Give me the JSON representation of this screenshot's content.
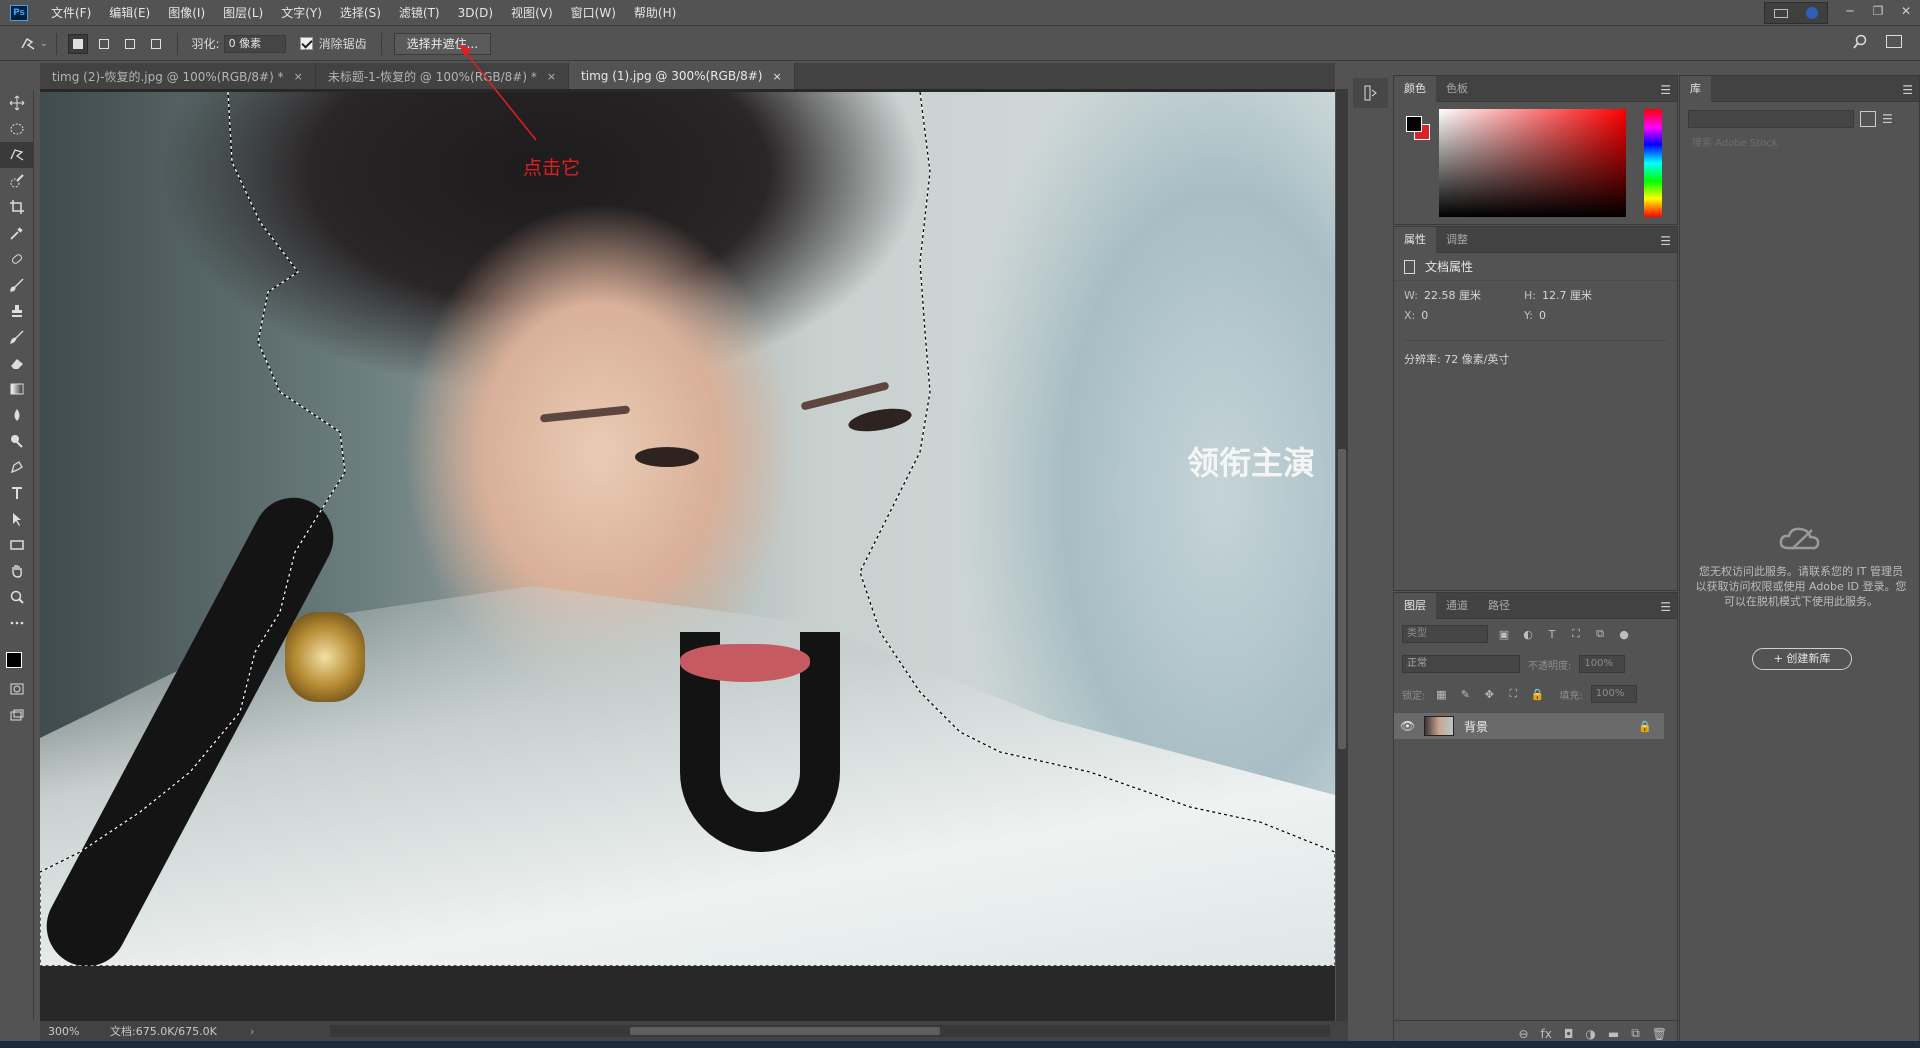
{
  "app": {
    "logo": "Ps"
  },
  "menu": [
    "文件(F)",
    "编辑(E)",
    "图像(I)",
    "图层(L)",
    "文字(Y)",
    "选择(S)",
    "滤镜(T)",
    "3D(D)",
    "视图(V)",
    "窗口(W)",
    "帮助(H)"
  ],
  "options": {
    "feather_label": "羽化:",
    "feather_value": "0 像素",
    "antialias_label": "消除锯齿",
    "select_mask_label": "选择并遮住..."
  },
  "tabs": [
    {
      "label": "timg (2)-恢复的.jpg @ 100%(RGB/8#) *",
      "close": "×"
    },
    {
      "label": "未标题-1-恢复的 @ 100%(RGB/8#) *",
      "close": "×"
    },
    {
      "label": "timg (1).jpg @ 300%(RGB/8#)",
      "close": "×"
    }
  ],
  "annotation": {
    "text": "点击它",
    "color": "#e02020"
  },
  "watermark": {
    "line": "领衔主演"
  },
  "status": {
    "zoom": "300%",
    "doc": "文档:675.0K/675.0K"
  },
  "color_panel": {
    "tabs": [
      "颜色",
      "色板"
    ],
    "foreground": "#000000",
    "background": "#d8232a"
  },
  "properties_panel": {
    "tabs": [
      "属性",
      "调整"
    ],
    "title": "文档属性",
    "w_label": "W:",
    "w_value": "22.58 厘米",
    "h_label": "H:",
    "h_value": "12.7 厘米",
    "x_label": "X:",
    "x_value": "0",
    "y_label": "Y:",
    "y_value": "0",
    "resolution": "分辨率: 72 像素/英寸"
  },
  "layers_panel": {
    "tabs": [
      "图层",
      "通道",
      "路径"
    ],
    "kind_placeholder": "类型",
    "blend_mode": "正常",
    "opacity_label": "不透明度:",
    "opacity_value": "100%",
    "lock_label": "锁定:",
    "fill_label": "填充:",
    "fill_value": "100%",
    "layer_name": "背景"
  },
  "library_panel": {
    "tab": "库",
    "search_placeholder": "搜索 Adobe Stock",
    "message": "您无权访问此服务。请联系您的 IT 管理员以获取访问权限或使用 Adobe ID 登录。您可以在脱机模式下使用此服务。",
    "create_button": "+ 创建新库"
  }
}
